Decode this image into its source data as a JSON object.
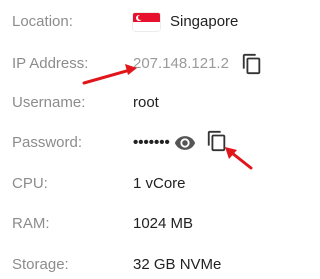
{
  "server_info": {
    "location": {
      "label": "Location:",
      "value": "Singapore",
      "flag_icon": "singapore-flag-icon"
    },
    "ip_address": {
      "label": "IP Address:",
      "value": "207.148.121.2",
      "copy_icon": "copy-icon"
    },
    "username": {
      "label": "Username:",
      "value": "root"
    },
    "password": {
      "label": "Password:",
      "value": "•••••••",
      "reveal_icon": "eye-icon",
      "copy_icon": "copy-icon"
    },
    "cpu": {
      "label": "CPU:",
      "value": "1 vCore"
    },
    "ram": {
      "label": "RAM:",
      "value": "1024 MB"
    },
    "storage": {
      "label": "Storage:",
      "value": "32 GB NVMe"
    }
  },
  "colors": {
    "label": "#8c8c8c",
    "value": "#222222",
    "annotation_arrow": "#e0161b",
    "icon": "#333333"
  }
}
